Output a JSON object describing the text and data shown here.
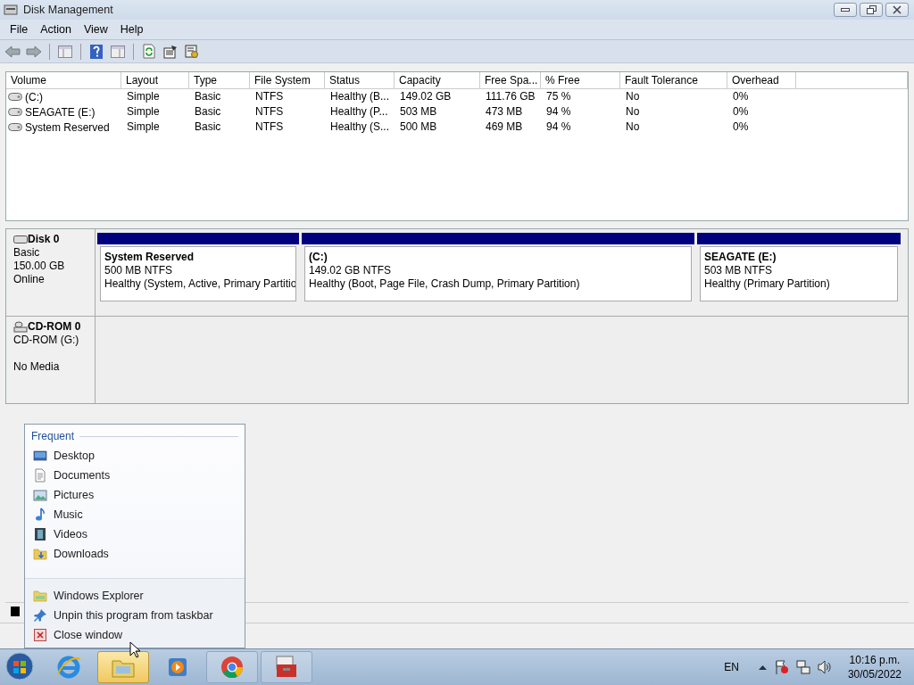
{
  "window": {
    "title": "Disk Management"
  },
  "menu": [
    "File",
    "Action",
    "View",
    "Help"
  ],
  "volumes": {
    "columns": [
      "Volume",
      "Layout",
      "Type",
      "File System",
      "Status",
      "Capacity",
      "Free Spa...",
      "% Free",
      "Fault Tolerance",
      "Overhead"
    ],
    "rows": [
      [
        "(C:)",
        "Simple",
        "Basic",
        "NTFS",
        "Healthy (B...",
        "149.02 GB",
        "111.76 GB",
        "75 %",
        "No",
        "0%"
      ],
      [
        "SEAGATE (E:)",
        "Simple",
        "Basic",
        "NTFS",
        "Healthy (P...",
        "503 MB",
        "473 MB",
        "94 %",
        "No",
        "0%"
      ],
      [
        "System Reserved",
        "Simple",
        "Basic",
        "NTFS",
        "Healthy (S...",
        "500 MB",
        "469 MB",
        "94 %",
        "No",
        "0%"
      ]
    ]
  },
  "disks": [
    {
      "kind": "disk",
      "name": "Disk 0",
      "lines": [
        "Basic",
        "150.00 GB",
        "Online"
      ],
      "partitions": [
        {
          "title": "System Reserved",
          "size": "500 MB NTFS",
          "status": "Healthy (System, Active, Primary Partitio"
        },
        {
          "title": "(C:)",
          "size": "149.02 GB NTFS",
          "status": "Healthy (Boot, Page File, Crash Dump, Primary Partition)"
        },
        {
          "title": "SEAGATE  (E:)",
          "size": "503 MB NTFS",
          "status": "Healthy (Primary Partition)"
        }
      ]
    },
    {
      "kind": "cdrom",
      "name": "CD-ROM 0",
      "lines": [
        "CD-ROM (G:)",
        "No Media"
      ]
    }
  ],
  "jump_list": {
    "heading": "Frequent",
    "frequent": [
      {
        "kind": "desktop",
        "label": "Desktop"
      },
      {
        "kind": "documents",
        "label": "Documents"
      },
      {
        "kind": "pictures",
        "label": "Pictures"
      },
      {
        "kind": "music",
        "label": "Music"
      },
      {
        "kind": "videos",
        "label": "Videos"
      },
      {
        "kind": "downloads",
        "label": "Downloads"
      }
    ],
    "tasks": [
      {
        "kind": "explorer",
        "label": "Windows Explorer"
      },
      {
        "kind": "unpin",
        "label": "Unpin this program from taskbar"
      },
      {
        "kind": "close",
        "label": "Close window"
      }
    ]
  },
  "taskbar": {
    "apps": [
      {
        "kind": "ie",
        "selected": false
      },
      {
        "kind": "explorer",
        "selected": true
      },
      {
        "kind": "media",
        "selected": false
      },
      {
        "kind": "chrome",
        "selected": false
      },
      {
        "kind": "toolbox",
        "selected": false
      }
    ],
    "language": "EN",
    "time": "10:16 p.m.",
    "date": "30/05/2022"
  }
}
